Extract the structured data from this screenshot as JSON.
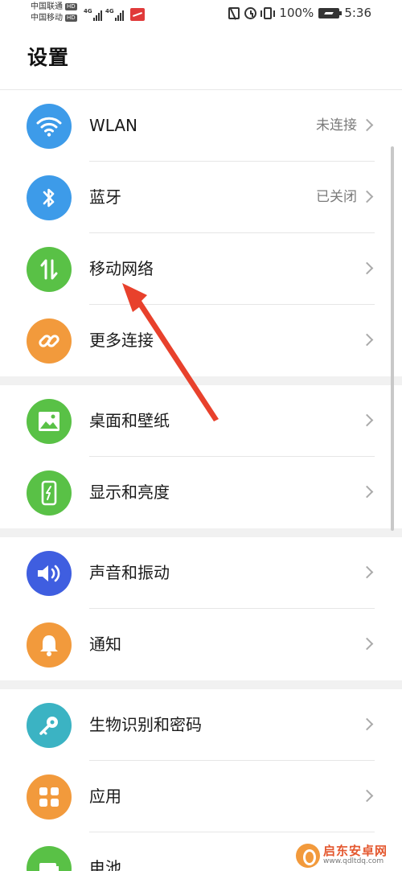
{
  "status_bar": {
    "carrier_1": "中国联通",
    "carrier_2": "中国移动",
    "hd_badge": "HD",
    "network_type": "4G",
    "battery_percent": "100%",
    "time": "5:36",
    "icons": [
      "nfc-icon",
      "alarm-icon",
      "vibrate-icon",
      "battery-icon",
      "signal-icon"
    ]
  },
  "header": {
    "title": "设置"
  },
  "settings": {
    "wlan": {
      "label": "WLAN",
      "value": "未连接",
      "icon": "wifi-icon",
      "color": "#3d9be9"
    },
    "bluetooth": {
      "label": "蓝牙",
      "value": "已关闭",
      "icon": "bluetooth-icon",
      "color": "#3d9be9"
    },
    "mobile_network": {
      "label": "移动网络",
      "icon": "mobile-data-icon",
      "color": "#59c146"
    },
    "more_connections": {
      "label": "更多连接",
      "icon": "link-icon",
      "color": "#f29a3c"
    },
    "wallpaper": {
      "label": "桌面和壁纸",
      "icon": "image-icon",
      "color": "#59c146"
    },
    "display": {
      "label": "显示和亮度",
      "icon": "display-icon",
      "color": "#59c146"
    },
    "sound": {
      "label": "声音和振动",
      "icon": "speaker-icon",
      "color": "#3f5ee0"
    },
    "notifications": {
      "label": "通知",
      "icon": "bell-icon",
      "color": "#f29a3c"
    },
    "biometrics": {
      "label": "生物识别和密码",
      "icon": "key-icon",
      "color": "#3bb3c3"
    },
    "apps": {
      "label": "应用",
      "icon": "apps-grid-icon",
      "color": "#f29a3c"
    },
    "battery": {
      "label": "电池",
      "icon": "battery-setting-icon",
      "color": "#59c146"
    }
  },
  "annotation": {
    "arrow_color": "#e8412c"
  },
  "watermark": {
    "title": "启东安卓网",
    "url": "www.qdltdq.com"
  }
}
